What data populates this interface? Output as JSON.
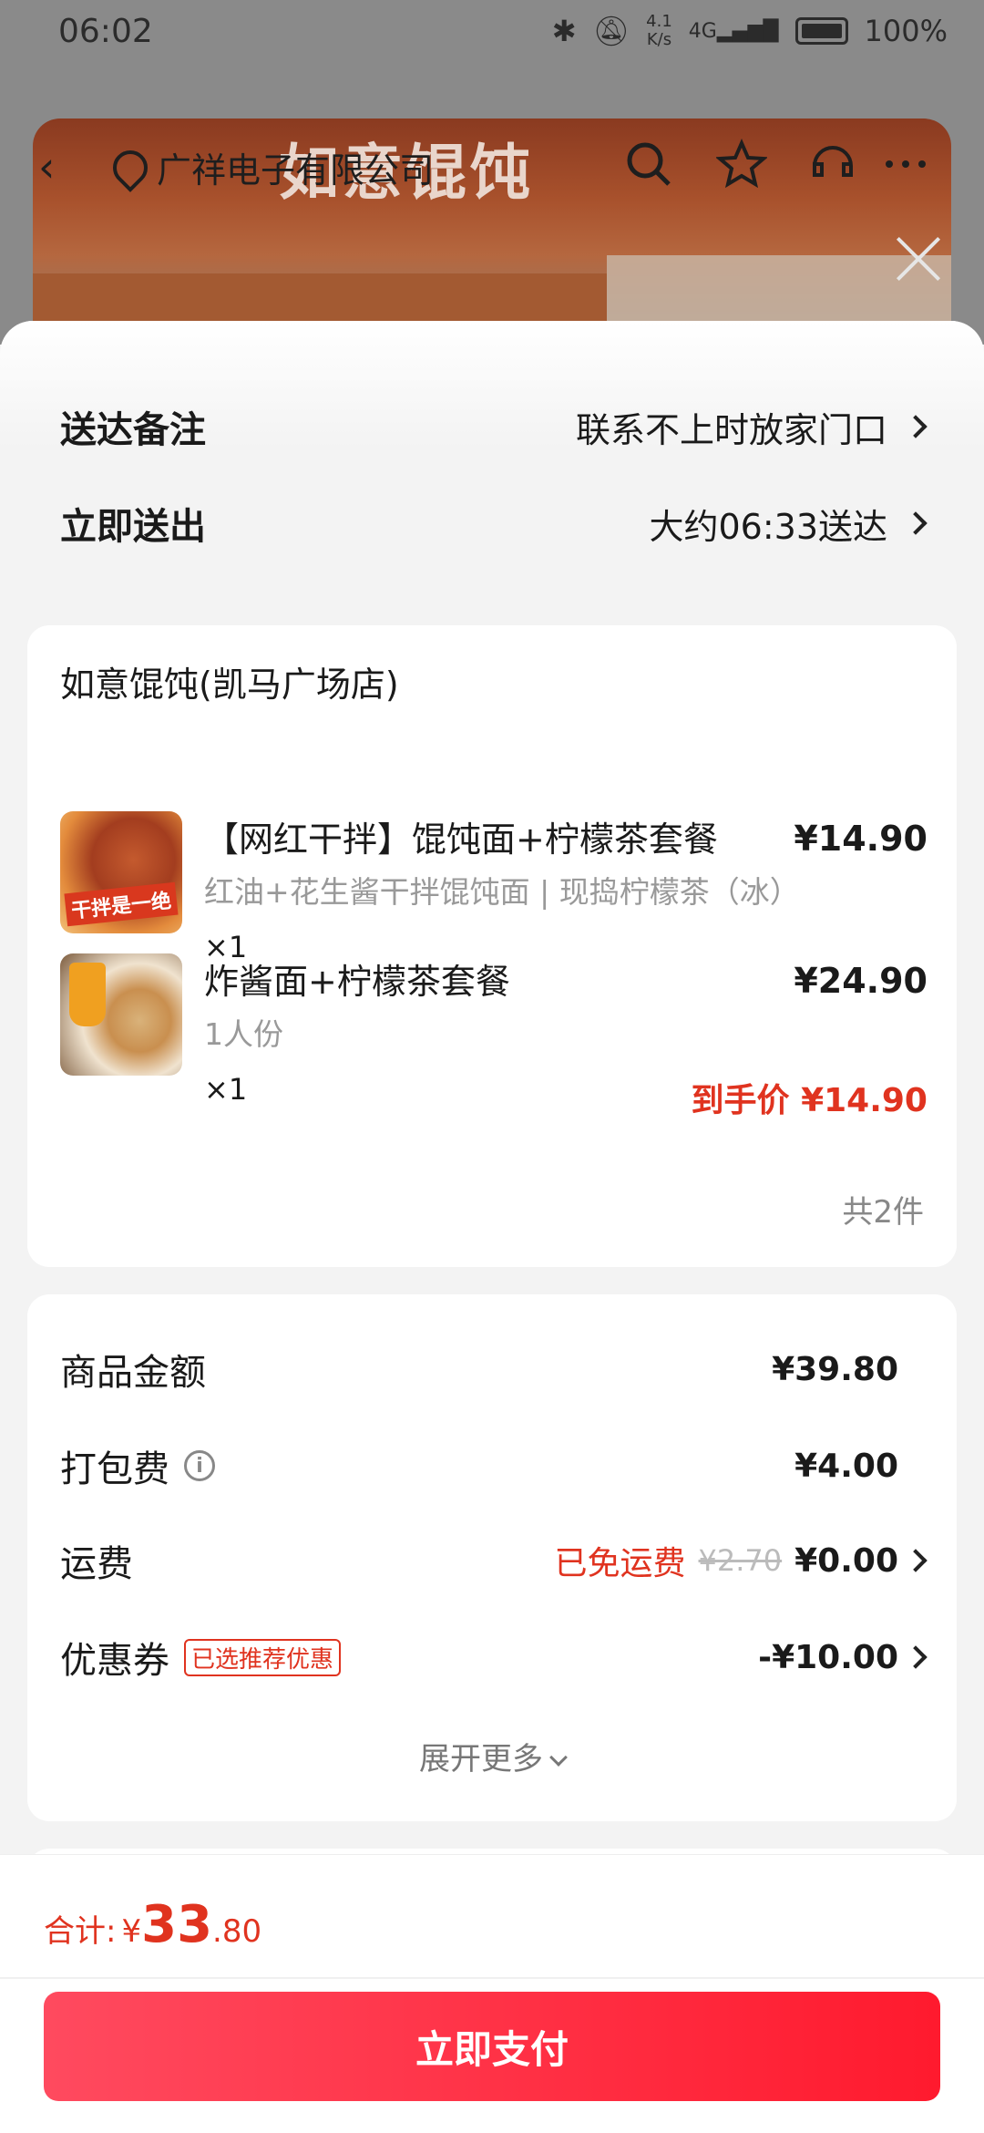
{
  "status_bar": {
    "time": "06:02",
    "net_speed_top": "4.1",
    "net_speed_bottom": "K/s",
    "signal": "4G",
    "battery": "100%"
  },
  "background": {
    "address": "广祥电子有限公司",
    "shop_sign": "如意馄饨"
  },
  "delivery": {
    "remark_label": "送达备注",
    "remark_value": "联系不上时放家门口",
    "time_label": "立即送出",
    "time_value": "大约06:33送达"
  },
  "order": {
    "store_name": "如意馄饨(凯马广场店)",
    "items": [
      {
        "name": "【网红干拌】馄饨面+柠檬茶套餐",
        "desc": "红油+花生酱干拌馄饨面 | 现捣柠檬茶（冰）",
        "qty": "×1",
        "price": "¥14.90",
        "thumb_tag": "干拌是一绝"
      },
      {
        "name": "炸酱面+柠檬茶套餐",
        "desc": "1人份",
        "qty": "×1",
        "price": "¥24.90",
        "deal": "到手价 ¥14.90"
      }
    ],
    "count": "共2件"
  },
  "fees": {
    "goods_label": "商品金额",
    "goods_value": "¥39.80",
    "pack_label": "打包费",
    "pack_value": "¥4.00",
    "ship_label": "运费",
    "ship_free": "已免运费",
    "ship_original": "¥2.70",
    "ship_value": "¥0.00",
    "coupon_label": "优惠券",
    "coupon_tag": "已选推荐优惠",
    "coupon_value": "-¥10.00",
    "expand": "展开更多"
  },
  "footer": {
    "total_label": "合计:",
    "currency": "¥",
    "total_int": "33",
    "total_dec": ".80",
    "pay_label": "立即支付"
  },
  "colors": {
    "accent_red": "#e0331f",
    "pay_gradient_start": "#ff4a5f",
    "pay_gradient_end": "#ff1a2e"
  }
}
